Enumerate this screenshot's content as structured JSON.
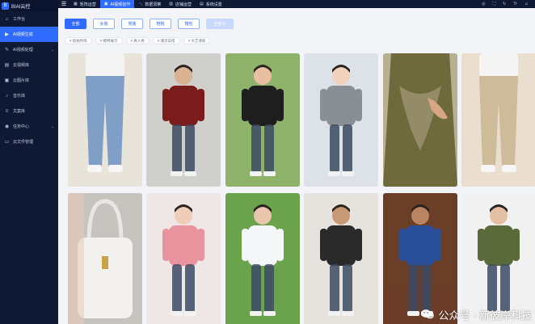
{
  "brand": {
    "logo_letter": "B",
    "name": "BIAI云控"
  },
  "sidebar": {
    "items": [
      {
        "label": "工作台",
        "icon": "home-icon",
        "glyph": "⌂",
        "active": false,
        "expandable": false
      },
      {
        "label": "AI视频生成",
        "icon": "video-icon",
        "glyph": "▶",
        "active": true,
        "expandable": false
      },
      {
        "label": "AI视频处理",
        "icon": "edit-icon",
        "glyph": "✎",
        "active": false,
        "expandable": true
      },
      {
        "label": "云视频库",
        "icon": "folder-icon",
        "glyph": "▤",
        "active": false,
        "expandable": false
      },
      {
        "label": "云图片库",
        "icon": "image-icon",
        "glyph": "▣",
        "active": false,
        "expandable": false
      },
      {
        "label": "音乐库",
        "icon": "music-icon",
        "glyph": "♪",
        "active": false,
        "expandable": false
      },
      {
        "label": "文案库",
        "icon": "document-icon",
        "glyph": "≡",
        "active": false,
        "expandable": false
      },
      {
        "label": "任务中心",
        "icon": "task-icon",
        "glyph": "◉",
        "active": false,
        "expandable": true
      },
      {
        "label": "云文件管理",
        "icon": "file-icon",
        "glyph": "▭",
        "active": false,
        "expandable": false
      }
    ]
  },
  "topbar": {
    "tabs": [
      {
        "label": "矩阵运营",
        "icon": "grid-icon",
        "glyph": "▦",
        "active": false
      },
      {
        "label": "AI视频创作",
        "icon": "film-icon",
        "glyph": "▣",
        "active": true
      },
      {
        "label": "数据洞察",
        "icon": "chart-icon",
        "glyph": "〽",
        "active": false
      },
      {
        "label": "店铺运营",
        "icon": "store-icon",
        "glyph": "▥",
        "active": false
      },
      {
        "label": "系统设置",
        "icon": "settings-icon",
        "glyph": "▤",
        "active": false
      }
    ],
    "right_icons": [
      {
        "name": "location-icon",
        "glyph": "◎"
      },
      {
        "name": "fullscreen-icon",
        "glyph": "⛶"
      },
      {
        "name": "refresh-icon",
        "glyph": "↻"
      },
      {
        "name": "translate-icon",
        "glyph": "Tr"
      },
      {
        "name": "user-icon",
        "glyph": "☺"
      }
    ]
  },
  "categories": [
    {
      "label": "全部",
      "state": "active"
    },
    {
      "label": "女装",
      "state": "normal"
    },
    {
      "label": "男装",
      "state": "normal"
    },
    {
      "label": "鞋靴",
      "state": "normal"
    },
    {
      "label": "箱包",
      "state": "normal"
    },
    {
      "label": "全部分",
      "state": "dim"
    }
  ],
  "tags": [
    {
      "label": "# 街拍时尚"
    },
    {
      "label": "# 模特展示"
    },
    {
      "label": "# 真人秀"
    },
    {
      "label": "# 潮流穿搭"
    },
    {
      "label": "# 文艺清新"
    }
  ],
  "gallery": {
    "rows": [
      [
        {
          "name": "photo-jeans-street",
          "bg": "#e9e4da",
          "accent": "#7f9fc7",
          "skin": "#f1d6c4",
          "kind": "legs"
        },
        {
          "name": "photo-man-red-shirt",
          "bg": "#cfcfcb",
          "accent": "#7a1c1c",
          "skin": "#d9b193",
          "kind": "person"
        },
        {
          "name": "photo-black-tee-woman",
          "bg": "#8fb26a",
          "accent": "#1e1e1e",
          "skin": "#e8bfa0",
          "kind": "person"
        },
        {
          "name": "photo-grey-trousers",
          "bg": "#dde2e8",
          "accent": "#8a8f95",
          "skin": "#f0d2bf",
          "kind": "person"
        },
        {
          "name": "photo-green-skirt",
          "bg": "#b8ae92",
          "accent": "#6f6a3c",
          "skin": "#d8a685",
          "kind": "detail"
        },
        {
          "name": "photo-beige-chinos",
          "bg": "#eadfce",
          "accent": "#cdbb99",
          "skin": "#e9c8b0",
          "kind": "legs"
        }
      ],
      [
        {
          "name": "photo-white-handbag",
          "bg": "#c7c4bf",
          "accent": "#f2f1ee",
          "skin": "#e6cbb7",
          "kind": "bag"
        },
        {
          "name": "photo-pink-activewear",
          "bg": "#efe7e6",
          "accent": "#e9939e",
          "skin": "#f0cdb8",
          "kind": "person"
        },
        {
          "name": "photo-white-hoodie",
          "bg": "#6aa34c",
          "accent": "#f4f6f8",
          "skin": "#e8c5ab",
          "kind": "person"
        },
        {
          "name": "photo-black-bag-woman",
          "bg": "#e6e3df",
          "accent": "#2a2a2a",
          "skin": "#c99875",
          "kind": "person"
        },
        {
          "name": "photo-blue-sweater-man",
          "bg": "#6b3e28",
          "accent": "#2a4f9a",
          "skin": "#b98462",
          "kind": "person"
        },
        {
          "name": "photo-olive-cargo",
          "bg": "#f1f1f1",
          "accent": "#5a6a3a",
          "skin": "#e3bfa3",
          "kind": "person"
        }
      ]
    ]
  },
  "watermark": {
    "text": "公众号 · 新彼岸科技"
  }
}
